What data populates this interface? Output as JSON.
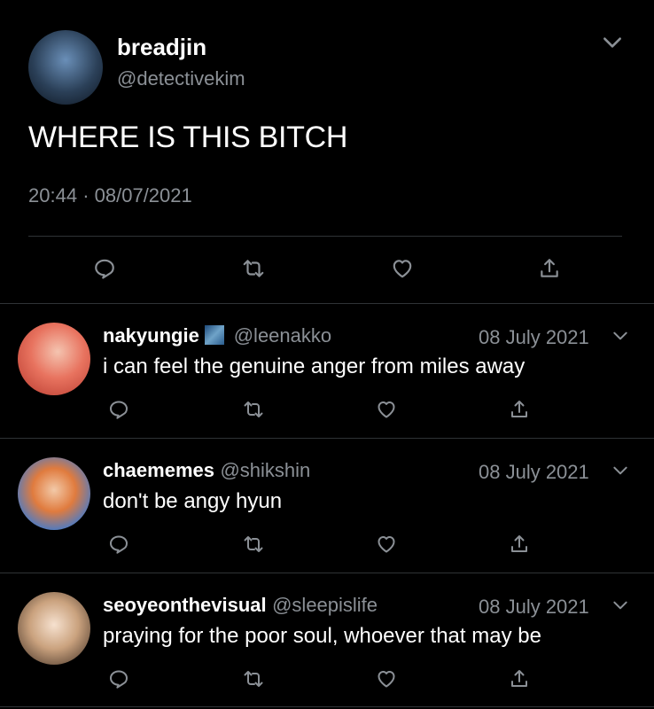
{
  "tweet": {
    "display_name": "breadjin",
    "handle": "@detectivekim",
    "text": "WHERE IS THIS BITCH",
    "time": "20:44",
    "sep": "·",
    "date": "08/07/2021"
  },
  "replies": [
    {
      "display_name": "nakyungie",
      "handle": "@leenakko",
      "date": "08 July 2021",
      "text": "i can feel the genuine anger from miles away",
      "avatar_color": "#e85a4f"
    },
    {
      "display_name": "chaememes",
      "handle": "@shikshin",
      "date": "08 July 2021",
      "text": "don't be angy hyun",
      "avatar_color": "#3b7bd4"
    },
    {
      "display_name": "seoyeonthevisual",
      "handle": "@sleepislife",
      "date": "08 July 2021",
      "text": "praying for the poor soul, whoever that may be",
      "avatar_color": "#caa27e"
    }
  ],
  "icons": {
    "reply": "reply-icon",
    "retweet": "retweet-icon",
    "like": "heart-icon",
    "share": "share-icon",
    "more": "chevron-down-icon"
  },
  "colors": {
    "background": "#000000",
    "text": "#ffffff",
    "muted": "#8b9096",
    "divider": "#2f3336"
  }
}
